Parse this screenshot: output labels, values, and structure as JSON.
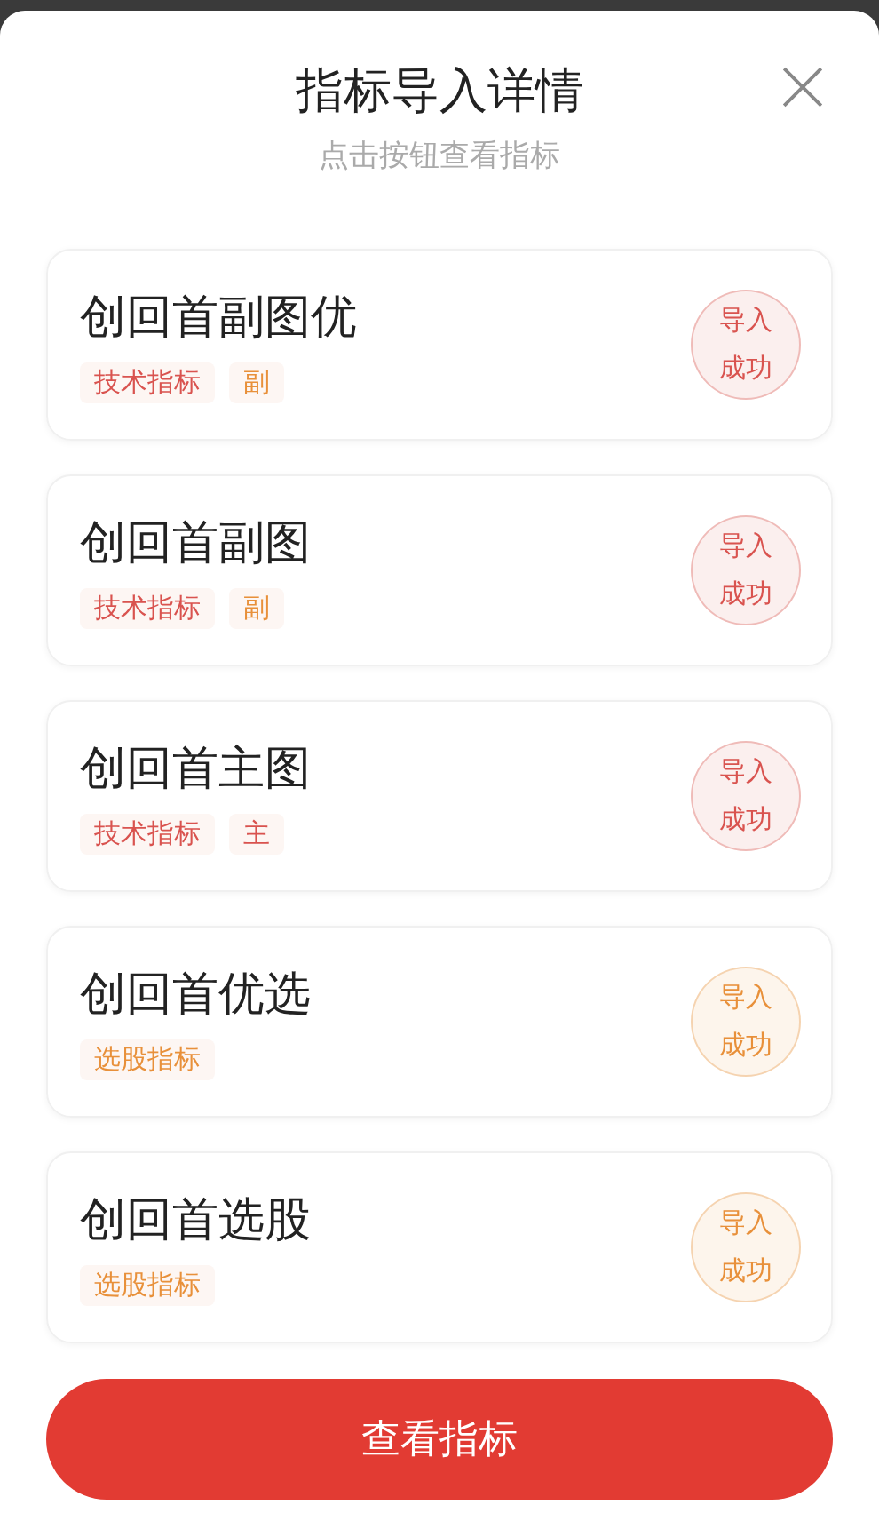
{
  "dialog": {
    "title": "指标导入详情",
    "subtitle": "点击按钮查看指标"
  },
  "indicators": [
    {
      "name": "创回首副图优",
      "tags": [
        {
          "label": "技术指标",
          "color": "#d9534f"
        },
        {
          "label": "副",
          "color": "#e8903a"
        }
      ],
      "status": "导入成功",
      "color": "#d9534f"
    },
    {
      "name": "创回首副图",
      "tags": [
        {
          "label": "技术指标",
          "color": "#d9534f"
        },
        {
          "label": "副",
          "color": "#e8903a"
        }
      ],
      "status": "导入成功",
      "color": "#d9534f"
    },
    {
      "name": "创回首主图",
      "tags": [
        {
          "label": "技术指标",
          "color": "#d9534f"
        },
        {
          "label": "主",
          "color": "#d9534f"
        }
      ],
      "status": "导入成功",
      "color": "#d9534f"
    },
    {
      "name": "创回首优选",
      "tags": [
        {
          "label": "选股指标",
          "color": "#e8903a"
        }
      ],
      "status": "导入成功",
      "color": "#e8903a"
    },
    {
      "name": "创回首选股",
      "tags": [
        {
          "label": "选股指标",
          "color": "#e8903a"
        }
      ],
      "status": "导入成功",
      "color": "#e8903a"
    }
  ],
  "button": "查看指标"
}
